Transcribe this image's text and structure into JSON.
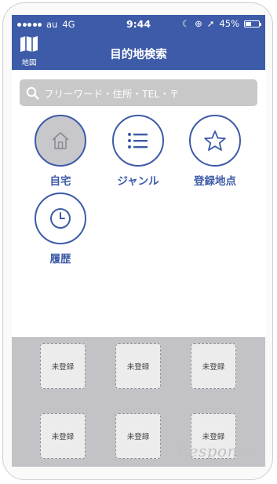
{
  "status": {
    "carrier": "au",
    "network": "4G",
    "time": "9:44",
    "battery": "45%",
    "battery_level": 0.45
  },
  "nav": {
    "map_label": "地図",
    "title": "目的地検索"
  },
  "search": {
    "placeholder": "フリーワード・住所・TEL・〒"
  },
  "categories": [
    {
      "label": "自宅",
      "icon": "home-icon"
    },
    {
      "label": "ジャンル",
      "icon": "list-icon"
    },
    {
      "label": "登録地点",
      "icon": "star-icon"
    },
    {
      "label": "履歴",
      "icon": "clock-icon"
    }
  ],
  "slots": [
    "未登録",
    "未登録",
    "未登録",
    "未登録",
    "未登録",
    "未登録"
  ],
  "watermark": "Response",
  "colors": {
    "accent": "#3d5ba8",
    "search_bg": "#c8c8c8",
    "slot_area": "#c2c2c7"
  }
}
